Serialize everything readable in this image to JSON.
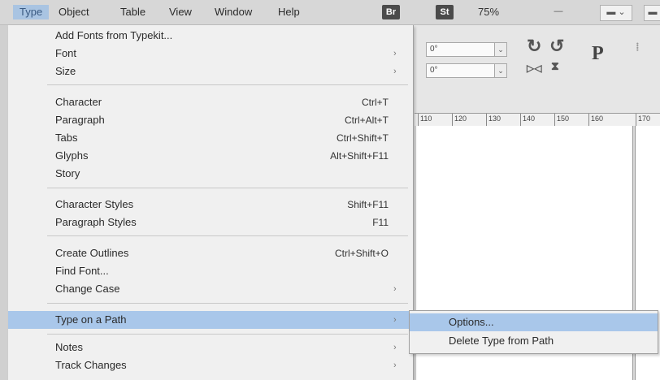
{
  "menubar": {
    "items": [
      "Type",
      "Object",
      "Table",
      "View",
      "Window",
      "Help"
    ],
    "badges": [
      "Br",
      "St"
    ],
    "zoom": "75%"
  },
  "control_panel": {
    "field1": "0°",
    "field2": "0°",
    "p_glyph": "P"
  },
  "ruler": {
    "ticks": [
      "110",
      "120",
      "130",
      "140",
      "150",
      "160",
      "170"
    ]
  },
  "type_menu": {
    "items": [
      {
        "label": "Add Fonts from Typekit...",
        "shortcut": "",
        "submenu": false
      },
      {
        "label": "Font",
        "shortcut": "",
        "submenu": true
      },
      {
        "label": "Size",
        "shortcut": "",
        "submenu": true
      },
      {
        "label": "Character",
        "shortcut": "Ctrl+T",
        "submenu": false
      },
      {
        "label": "Paragraph",
        "shortcut": "Ctrl+Alt+T",
        "submenu": false
      },
      {
        "label": "Tabs",
        "shortcut": "Ctrl+Shift+T",
        "submenu": false
      },
      {
        "label": "Glyphs",
        "shortcut": "Alt+Shift+F11",
        "submenu": false
      },
      {
        "label": "Story",
        "shortcut": "",
        "submenu": false
      },
      {
        "label": "Character Styles",
        "shortcut": "Shift+F11",
        "submenu": false
      },
      {
        "label": "Paragraph Styles",
        "shortcut": "F11",
        "submenu": false
      },
      {
        "label": "Create Outlines",
        "shortcut": "Ctrl+Shift+O",
        "submenu": false
      },
      {
        "label": "Find Font...",
        "shortcut": "",
        "submenu": false
      },
      {
        "label": "Change Case",
        "shortcut": "",
        "submenu": true
      },
      {
        "label": "Type on a Path",
        "shortcut": "",
        "submenu": true
      },
      {
        "label": "Notes",
        "shortcut": "",
        "submenu": true
      },
      {
        "label": "Track Changes",
        "shortcut": "",
        "submenu": true
      }
    ],
    "highlighted": "Type on a Path"
  },
  "submenu": {
    "items": [
      "Options...",
      "Delete Type from Path"
    ],
    "highlighted": "Options..."
  },
  "colors": {
    "highlight": "#a9c7ea",
    "menu_bg": "#f0f0f0"
  }
}
